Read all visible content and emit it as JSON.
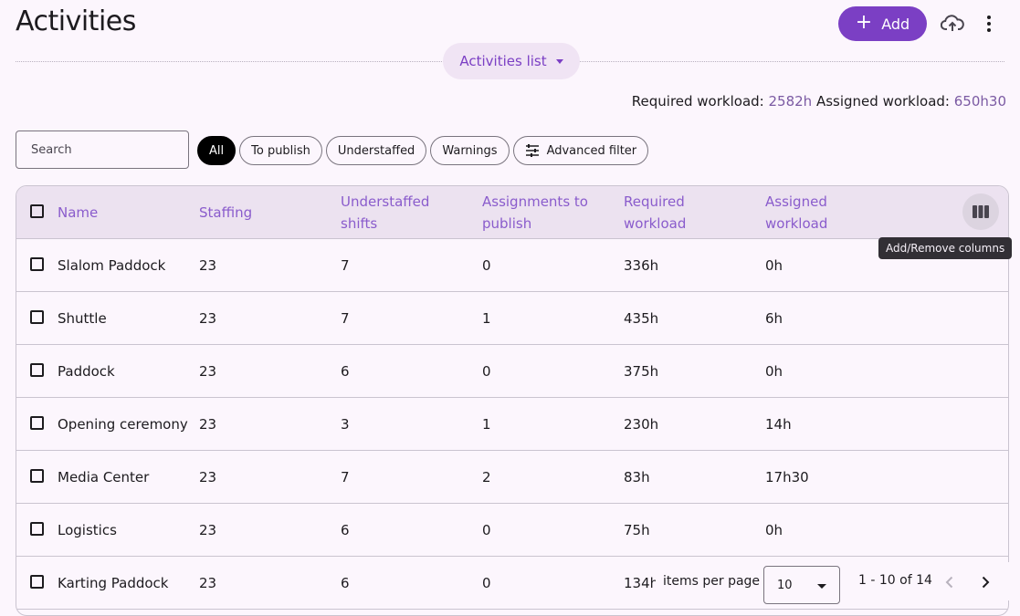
{
  "header": {
    "title": "Activities",
    "add_label": "Add",
    "view_label": "Activities list"
  },
  "workload": {
    "required_label": "Required workload:",
    "required_value": "2582h",
    "assigned_label": "Assigned workload:",
    "assigned_value": "650h30"
  },
  "search": {
    "placeholder": "Search"
  },
  "filters": {
    "all": "All",
    "to_publish": "To publish",
    "understaffed": "Understaffed",
    "warnings": "Warnings",
    "advanced": "Advanced filter"
  },
  "table": {
    "columns": {
      "name": "Name",
      "staffing": "Staffing",
      "understaffed_1": "Understaffed",
      "understaffed_2": "shifts",
      "assign_1": "Assignments to",
      "assign_2": "publish",
      "req_1": "Required",
      "req_2": "workload",
      "asg_1": "Assigned",
      "asg_2": "workload"
    },
    "rows": [
      {
        "name": "Slalom Paddock",
        "staffing": "23",
        "understaffed": "7",
        "to_publish": "0",
        "required": "336h",
        "assigned": "0h"
      },
      {
        "name": "Shuttle",
        "staffing": "23",
        "understaffed": "7",
        "to_publish": "1",
        "required": "435h",
        "assigned": "6h"
      },
      {
        "name": "Paddock",
        "staffing": "23",
        "understaffed": "6",
        "to_publish": "0",
        "required": "375h",
        "assigned": "0h"
      },
      {
        "name": "Opening ceremony",
        "staffing": "23",
        "understaffed": "3",
        "to_publish": "1",
        "required": "230h",
        "assigned": "14h"
      },
      {
        "name": "Media Center",
        "staffing": "23",
        "understaffed": "7",
        "to_publish": "2",
        "required": "83h",
        "assigned": "17h30"
      },
      {
        "name": "Logistics",
        "staffing": "23",
        "understaffed": "6",
        "to_publish": "0",
        "required": "75h",
        "assigned": "0h"
      },
      {
        "name": "Karting Paddock",
        "staffing": "23",
        "understaffed": "6",
        "to_publish": "0",
        "required": "134h",
        "assigned": ""
      }
    ]
  },
  "tooltip": "Add/Remove columns",
  "pagination": {
    "items_per_page_label": "items per page",
    "items_per_page": "10",
    "range": "1 - 10 of 14"
  },
  "colors": {
    "accent": "#7b3fc4",
    "header_bg": "#ece2f0",
    "page_bg": "#fcf6fd"
  },
  "icons": {
    "add": "plus-icon",
    "upload": "cloud-upload-icon",
    "more": "more-vert-icon",
    "search": "search-icon",
    "filter": "tune-icon",
    "columns": "view-column-icon"
  }
}
